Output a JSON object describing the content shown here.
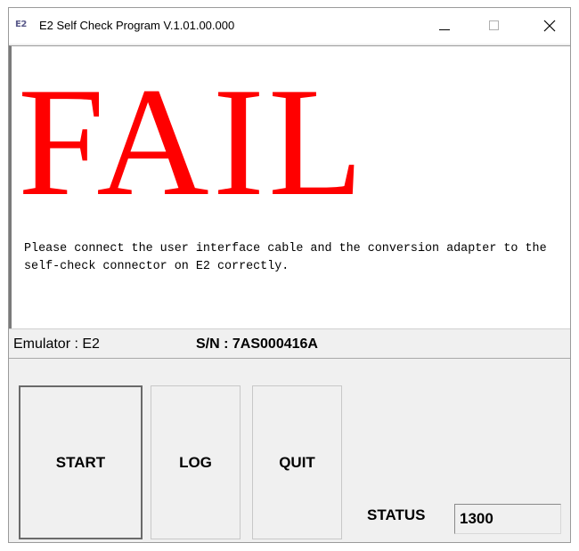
{
  "window": {
    "app_icon_text": "E2",
    "title": "E2 Self Check Program V.1.01.00.000",
    "controls": {
      "minimize": "minimize-icon",
      "maximize": "maximize-icon",
      "close": "close-icon"
    }
  },
  "result": {
    "verdict": "FAIL",
    "verdict_color": "#ff0000",
    "message": "Please connect the user interface cable and the conversion adapter to the self-check connector on E2 correctly."
  },
  "info": {
    "emulator": "Emulator : E2",
    "serial": "S/N : 7AS000416A"
  },
  "buttons": {
    "start": "START",
    "log": "LOG",
    "quit": "QUIT"
  },
  "status": {
    "label": "STATUS",
    "value": "1300"
  }
}
